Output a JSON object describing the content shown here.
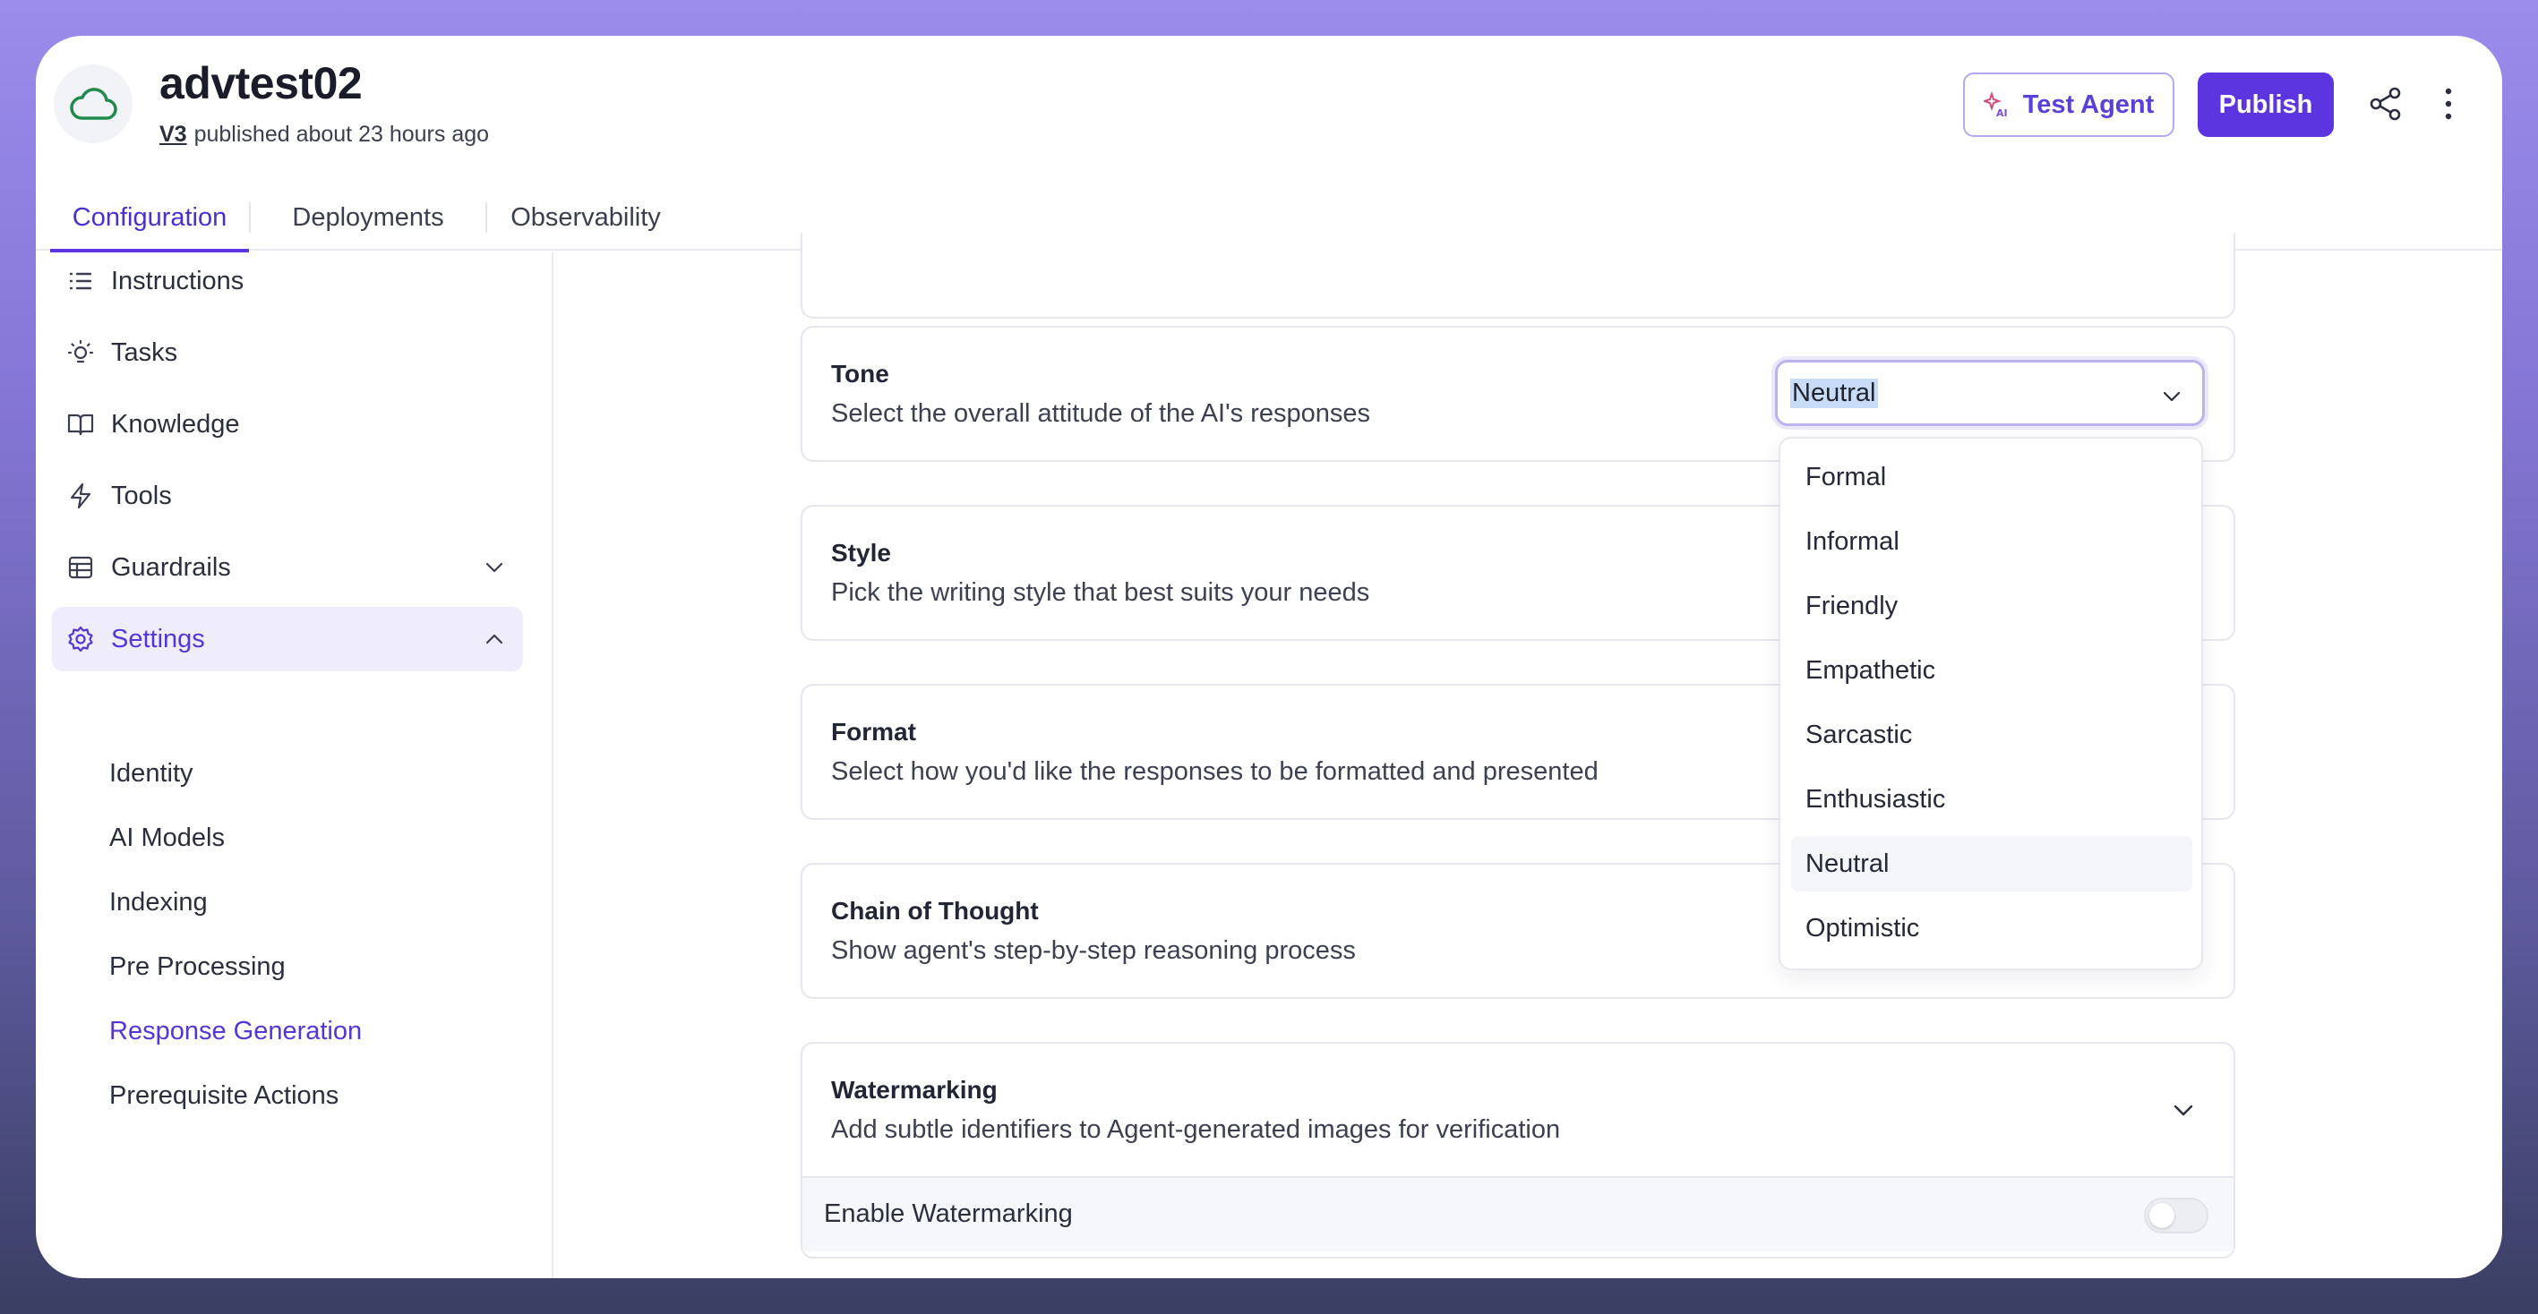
{
  "app": {
    "name": "advtest02",
    "version": "V3",
    "published_text": "published about 23 hours ago"
  },
  "header": {
    "test_agent_label": "Test Agent",
    "publish_label": "Publish"
  },
  "tabs": [
    {
      "label": "Configuration",
      "active": true
    },
    {
      "label": "Deployments",
      "active": false
    },
    {
      "label": "Observability",
      "active": false
    }
  ],
  "sidebar": {
    "items": [
      {
        "label": "Instructions",
        "icon": "list-icon"
      },
      {
        "label": "Tasks",
        "icon": "lightbulb-icon"
      },
      {
        "label": "Knowledge",
        "icon": "book-icon"
      },
      {
        "label": "Tools",
        "icon": "bolt-icon"
      },
      {
        "label": "Guardrails",
        "icon": "table-icon"
      },
      {
        "label": "Settings",
        "icon": "gear-icon",
        "active": true
      }
    ],
    "settings_subitems": [
      {
        "label": "Identity"
      },
      {
        "label": "AI Models"
      },
      {
        "label": "Indexing"
      },
      {
        "label": "Pre Processing"
      },
      {
        "label": "Response Generation",
        "active": true
      },
      {
        "label": "Prerequisite Actions"
      }
    ]
  },
  "main": {
    "tone": {
      "title": "Tone",
      "description": "Select the overall attitude of the AI's responses",
      "selected": "Neutral",
      "options": [
        "Formal",
        "Informal",
        "Friendly",
        "Empathetic",
        "Sarcastic",
        "Enthusiastic",
        "Neutral",
        "Optimistic"
      ]
    },
    "style": {
      "title": "Style",
      "description": "Pick the writing style that best suits your needs"
    },
    "format": {
      "title": "Format",
      "description": "Select how you'd like the responses to be formatted and presented"
    },
    "chain_of_thought": {
      "title": "Chain of Thought",
      "description": "Show agent's step-by-step reasoning process"
    },
    "watermarking": {
      "title": "Watermarking",
      "description": "Add subtle identifiers to Agent-generated images for verification",
      "enable_label": "Enable Watermarking",
      "enabled": false
    }
  },
  "colors": {
    "accent": "#5c35e0",
    "accent_text": "#5535d8",
    "active_nav_bg": "#efedfb",
    "logo_green": "#1f8a4c"
  }
}
